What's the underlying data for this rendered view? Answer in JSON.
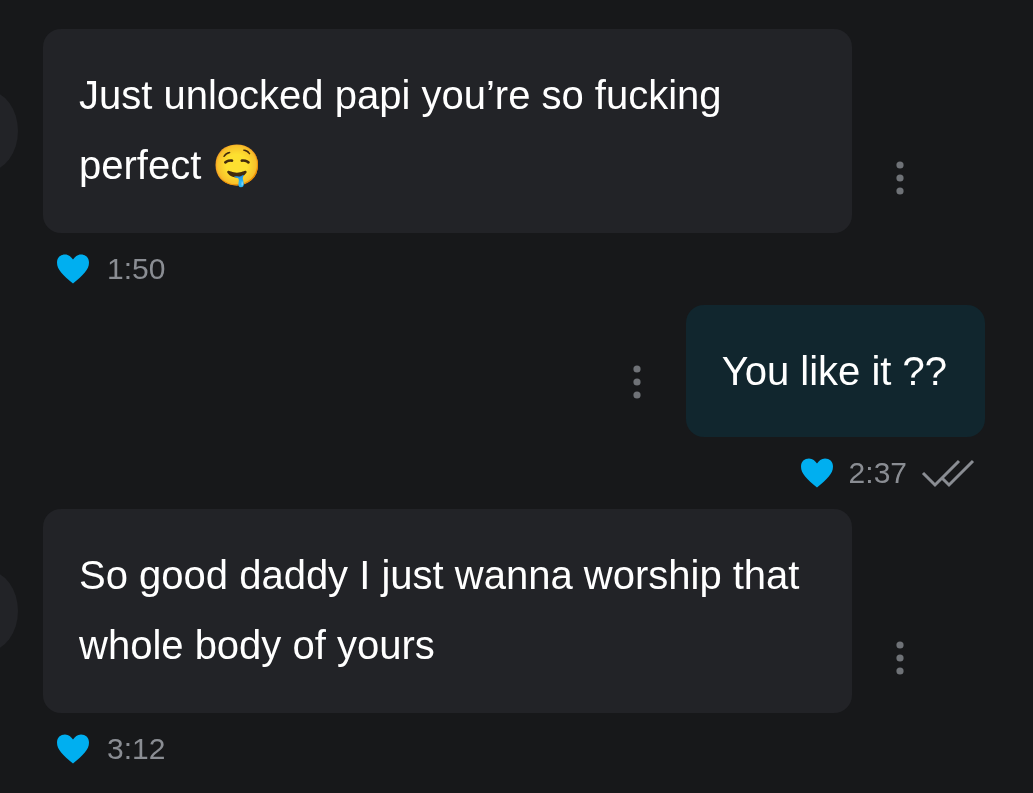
{
  "messages": [
    {
      "kind": "received",
      "text": "Just unlocked papi you’re so fucking perfect 🤤",
      "time": "1:50",
      "liked": true
    },
    {
      "kind": "sent",
      "text": "You like it ??",
      "time": "2:37",
      "liked": true,
      "read": true
    },
    {
      "kind": "received",
      "text": "So good daddy I just wanna worship that whole body of yours",
      "time": "3:12",
      "liked": true
    }
  ]
}
